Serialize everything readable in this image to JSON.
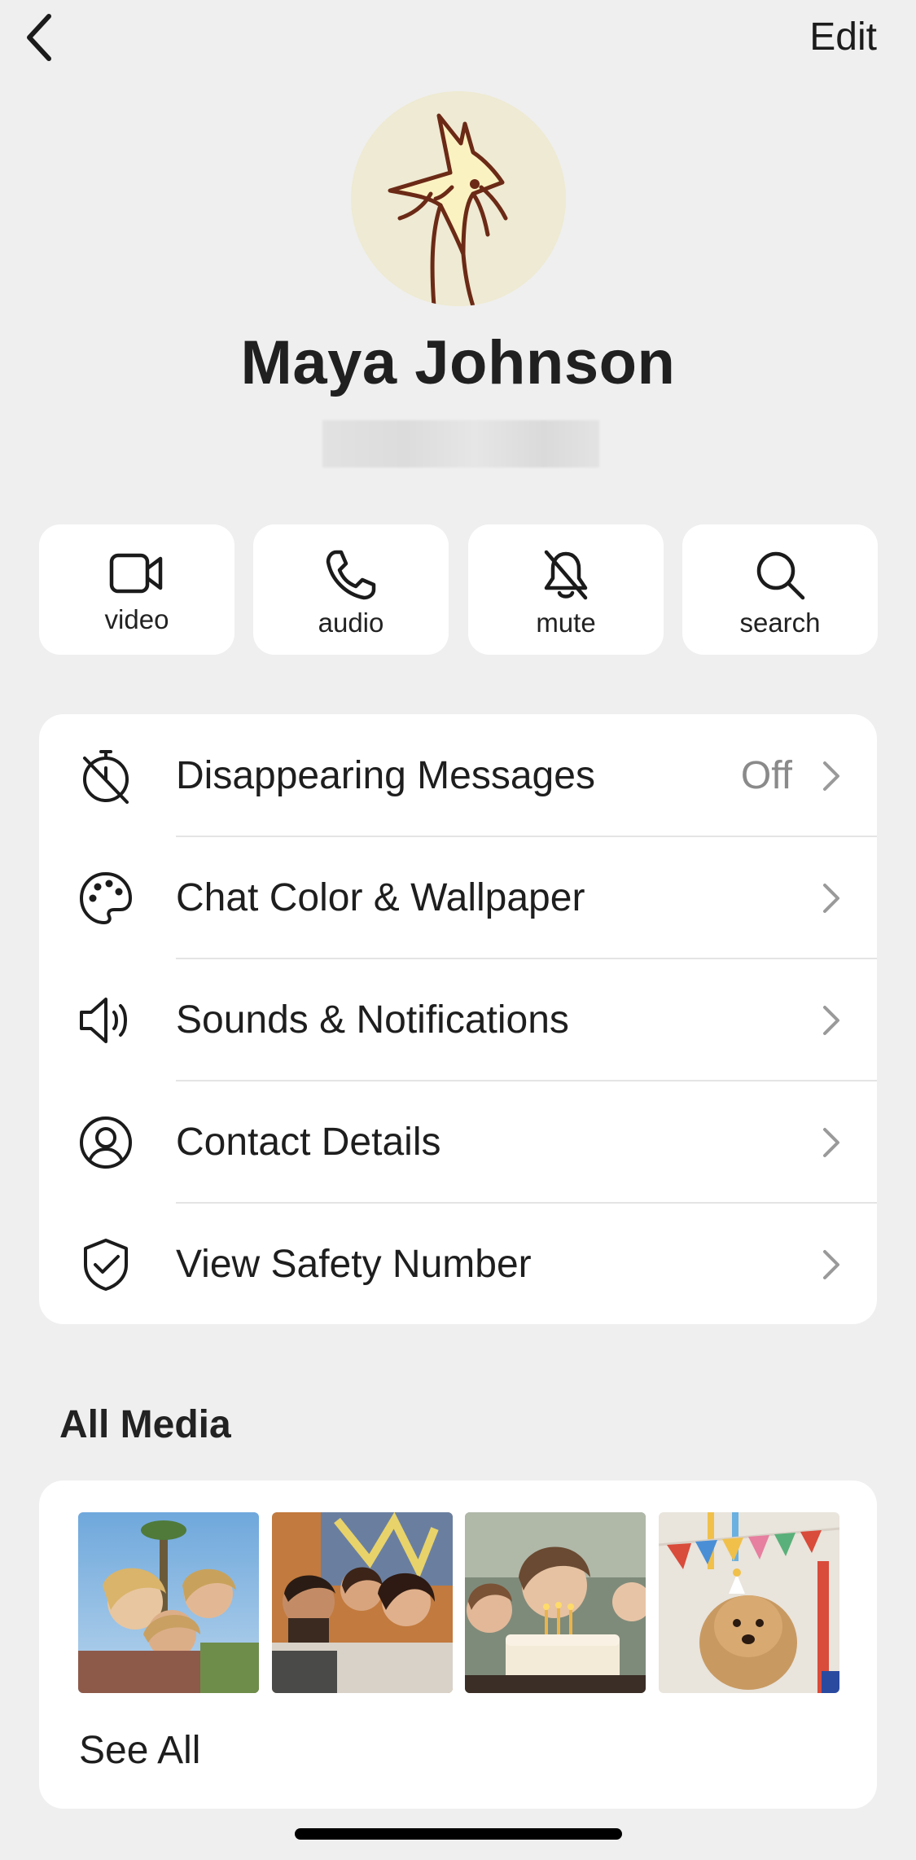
{
  "header": {
    "back_icon": "chevron-left-icon",
    "edit_label": "Edit"
  },
  "profile": {
    "avatar_icon": "fox-avatar-icon",
    "name": "Maya Johnson"
  },
  "actions": [
    {
      "label": "video",
      "icon": "video-camera-icon"
    },
    {
      "label": "audio",
      "icon": "phone-icon"
    },
    {
      "label": "mute",
      "icon": "bell-off-icon"
    },
    {
      "label": "search",
      "icon": "search-icon"
    }
  ],
  "settings": [
    {
      "label": "Disappearing Messages",
      "value": "Off",
      "icon": "timer-off-icon"
    },
    {
      "label": "Chat Color & Wallpaper",
      "value": "",
      "icon": "palette-icon"
    },
    {
      "label": "Sounds & Notifications",
      "value": "",
      "icon": "speaker-icon"
    },
    {
      "label": "Contact Details",
      "value": "",
      "icon": "person-circle-icon"
    },
    {
      "label": "View Safety Number",
      "value": "",
      "icon": "shield-check-icon"
    }
  ],
  "media": {
    "title": "All Media",
    "see_all": "See All",
    "thumbnails": [
      "friends-selfie-photo",
      "group-hug-photo",
      "birthday-cake-photo",
      "party-dog-photo"
    ]
  },
  "colors": {
    "background": "#efefef",
    "card": "#ffffff",
    "avatar_bg": "#eeead3",
    "fox_stroke": "#6b2a16",
    "fox_fill": "#fbf2c2",
    "secondary_text": "#8a8a8a"
  }
}
